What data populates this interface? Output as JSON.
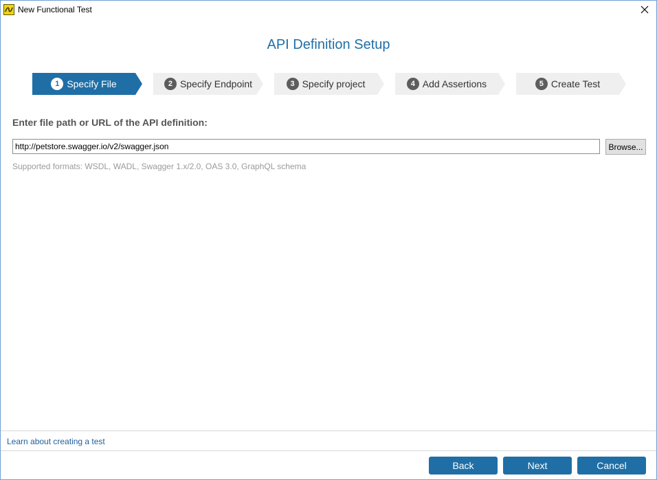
{
  "window": {
    "title": "New Functional Test",
    "icon": "app-logo-icon",
    "close_icon": "close-icon"
  },
  "page": {
    "heading": "API Definition Setup"
  },
  "stepper": {
    "active_color": "#1f6fa6",
    "inactive_color": "#efefef",
    "steps": [
      {
        "number": "1",
        "label": "Specify File",
        "state": "active"
      },
      {
        "number": "2",
        "label": "Specify Endpoint",
        "state": "inactive"
      },
      {
        "number": "3",
        "label": "Specify project",
        "state": "inactive"
      },
      {
        "number": "4",
        "label": "Add Assertions",
        "state": "inactive"
      },
      {
        "number": "5",
        "label": "Create Test",
        "state": "inactive"
      }
    ]
  },
  "form": {
    "label": "Enter file path or URL of the API definition:",
    "path_value": "http://petstore.swagger.io/v2/swagger.json",
    "browse_label": "Browse...",
    "hint": "Supported formats: WSDL, WADL, Swagger 1.x/2.0, OAS 3.0, GraphQL schema"
  },
  "footer": {
    "learn_link": "Learn about creating a test",
    "back_label": "Back",
    "next_label": "Next",
    "cancel_label": "Cancel",
    "button_color": "#1f6fa6"
  }
}
